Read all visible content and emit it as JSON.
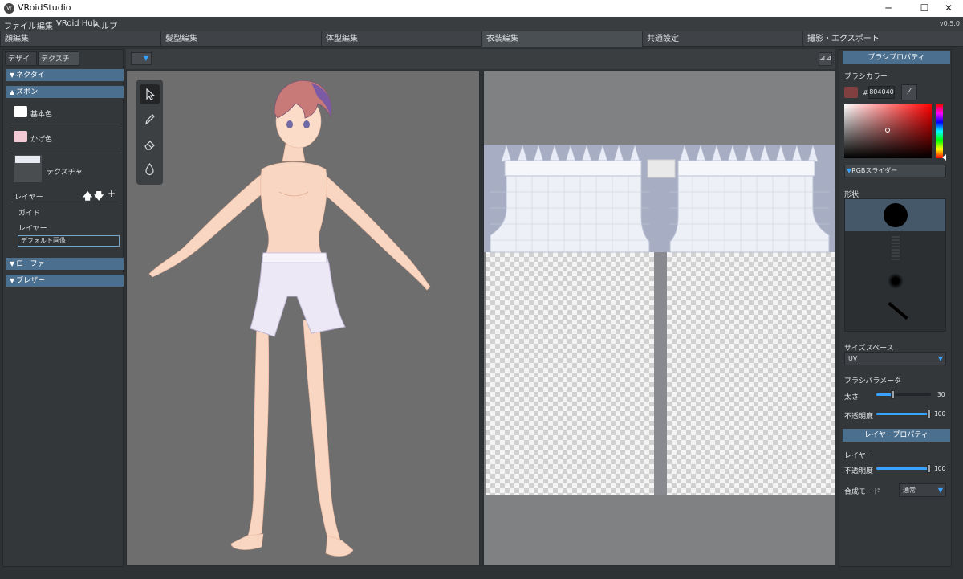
{
  "window": {
    "title": "VRoidStudio",
    "icon_text": "Vr",
    "minimize": "─",
    "maximize": "☐",
    "close": "✕"
  },
  "menu": {
    "items": [
      "ファイル",
      "編集",
      "VRoid Hub",
      "ヘルプ"
    ],
    "version": "v0.5.0"
  },
  "main_tabs": [
    "顔編集",
    "髪型編集",
    "体型編集",
    "衣装編集",
    "共通設定",
    "撮影・エクスポート"
  ],
  "active_main_tab": "衣装編集",
  "left_panel": {
    "sub_tabs": [
      "デザイン",
      "テクスチャ"
    ],
    "active_sub_tab": "テクスチャ",
    "sections": {
      "necktie": "ネクタイ",
      "pants": "ズボン",
      "loafer": "ローファー",
      "blazer": "ブレザー"
    },
    "base_color": {
      "label": "基本色",
      "color": "#ffffff"
    },
    "shade_color": {
      "label": "かげ色",
      "color": "#f4c9d6"
    },
    "texture_label": "テクスチャ",
    "layer_header": "レイヤー",
    "layer_buttons": {
      "up": "🡅",
      "down": "🡇",
      "add": "+"
    },
    "layers": [
      "ガイド",
      "レイヤー"
    ],
    "layer_name_input": "デフォルト画像"
  },
  "viewport_tools": [
    "select-tool",
    "pen-tool",
    "eraser-tool",
    "fill-tool"
  ],
  "toolbar": {
    "dropdown_arrow": "▼",
    "mirror_icon": "⊿⊿"
  },
  "brush_properties": {
    "header": "ブラシプロパティ",
    "brush_color_label": "ブラシカラー",
    "hex_prefix": "#",
    "hex_value": "804040",
    "color": "#804040",
    "rgb_slider_label": "RGBスライダー",
    "shape_label": "形状",
    "size_space_label": "サイズスペース",
    "size_space_value": "UV",
    "brush_params_label": "ブラシパラメータ",
    "thickness_label": "太さ",
    "thickness_value": "30",
    "thickness_fraction": 0.3,
    "opacity_label": "不透明度",
    "opacity_value": "100",
    "opacity_fraction": 1.0
  },
  "layer_properties": {
    "header": "レイヤープロパティ",
    "layer_label": "レイヤー",
    "opacity_label": "不透明度",
    "opacity_value": "100",
    "opacity_fraction": 1.0,
    "blend_mode_label": "合成モード",
    "blend_mode_value": "通常"
  }
}
